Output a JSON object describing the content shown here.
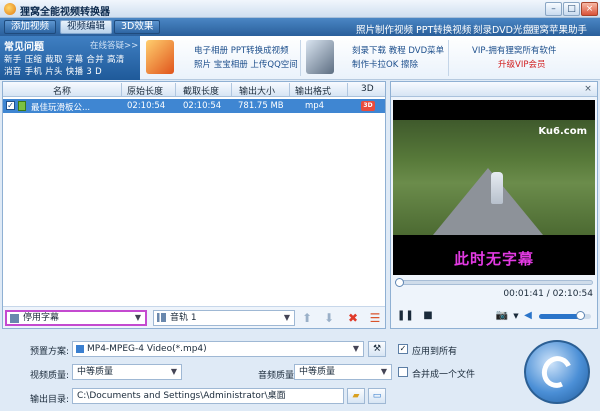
{
  "window": {
    "title": "狸窝全能视频转换器",
    "controls": [
      "–",
      "□",
      "×"
    ]
  },
  "nav": {
    "tabs": [
      {
        "label": "添加视频",
        "active": false
      },
      {
        "label": "视频编辑",
        "active": true
      },
      {
        "label": "3D效果",
        "active": false
      }
    ],
    "links": [
      "照片制作视频",
      "PPT转换视频",
      "刻录DVD光盘",
      "狸窝苹果助手"
    ]
  },
  "banner": {
    "faq": {
      "title": "常见问题",
      "online_help": "在线答疑>>",
      "row1": "新手 压缩 截取 字幕 合并 高清",
      "row2": "消音 手机 片头 快播 3 D"
    },
    "promo1": {
      "line1": "电子相册 PPT转换成视频",
      "line2": "照片 宝宝相册 上传QQ空间"
    },
    "promo2": {
      "line1": "刻录下载 教程 DVD菜单",
      "line2": "制作卡拉OK 擦除"
    },
    "promo3": {
      "line1": "VIP-拥有狸窝所有软件",
      "line2": "升级VIP会员"
    }
  },
  "file_list": {
    "columns": [
      "名称",
      "原始长度",
      "截取长度",
      "输出大小",
      "输出格式",
      "3D"
    ],
    "rows": [
      {
        "checked": true,
        "name": "最佳玩滑板公...",
        "original_length": "02:10:54",
        "clip_length": "02:10:54",
        "output_size": "781.75 MB",
        "output_format": "mp4",
        "three_d": "3D"
      }
    ]
  },
  "toolbar": {
    "subtitle_select": "停用字幕",
    "audio_select": "音轨 1",
    "buttons": [
      "move-up",
      "move-down",
      "delete",
      "clear"
    ]
  },
  "preview": {
    "watermark": "Ku6.com",
    "subtitle_text": "此时无字幕",
    "progress_fraction": 0.0,
    "timecode": "00:01:41 / 02:10:54",
    "volume_fraction": 0.8
  },
  "settings": {
    "preset_label": "预置方案:",
    "preset_value": "MP4-MPEG-4 Video(*.mp4)",
    "apply_all_label": "应用到所有",
    "apply_all_checked": true,
    "video_quality_label": "视频质量:",
    "video_quality_value": "中等质量",
    "audio_quality_label": "音频质量:",
    "audio_quality_value": "中等质量",
    "merge_label": "合并成一个文件",
    "merge_checked": false,
    "output_dir_label": "输出目录:",
    "output_dir_value": "C:\\Documents and Settings\\Administrator\\桌面"
  },
  "colors": {
    "accent": "#2a5f9b",
    "selected_row": "#3f86d2",
    "subtitle_text": "#e23ae2",
    "highlight_border": "#c44ad0"
  }
}
